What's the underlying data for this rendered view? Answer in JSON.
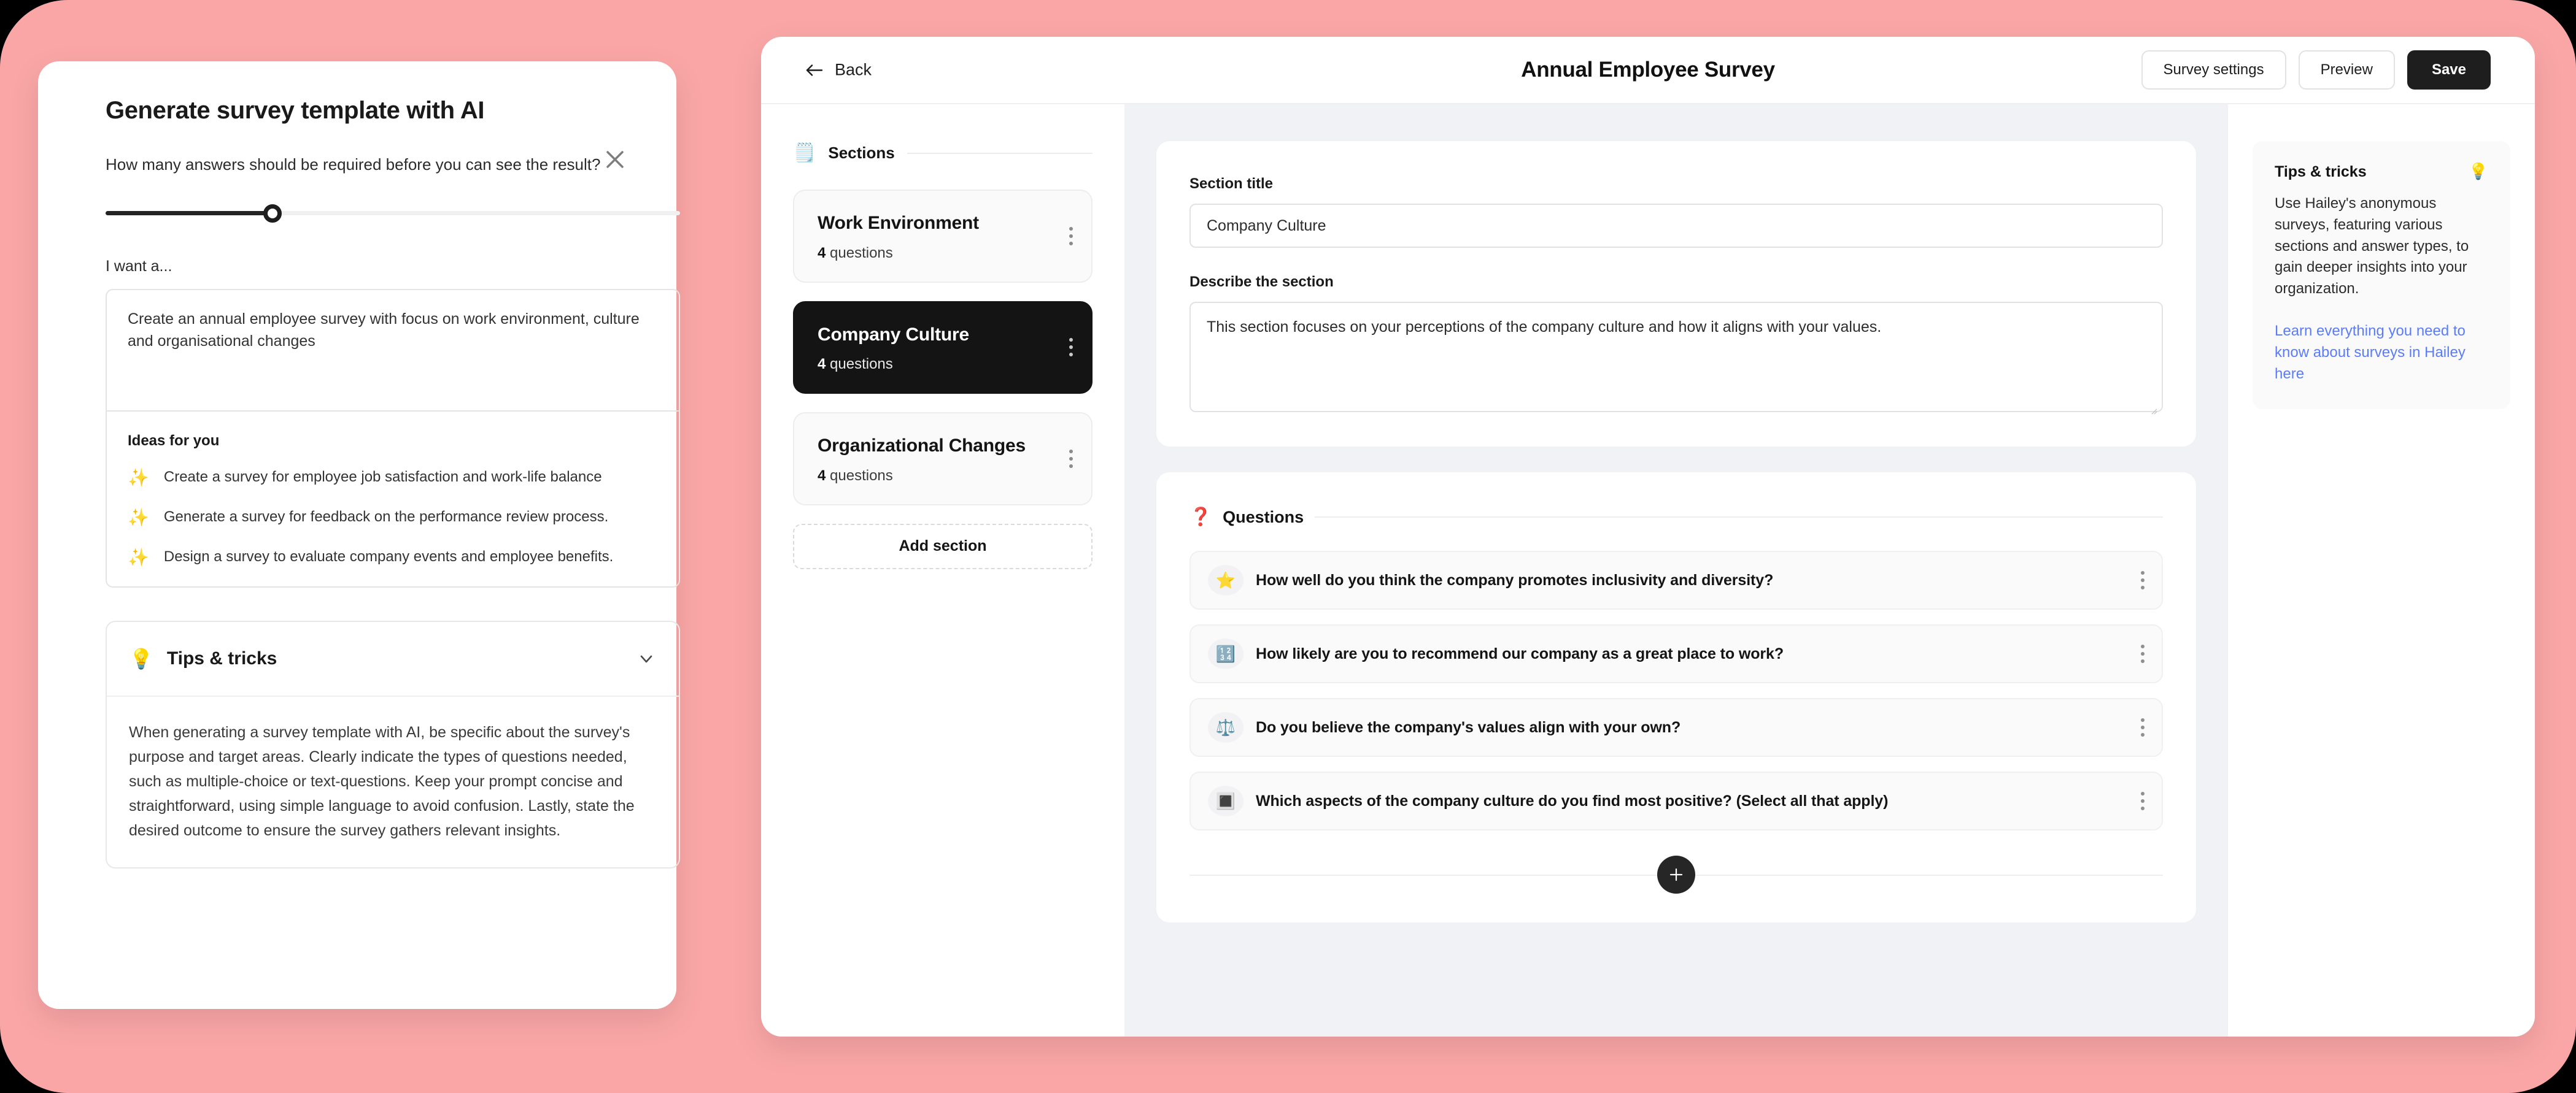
{
  "theme": {
    "page_background": "#FAA6A6",
    "accent_dark": "#1E1E1E",
    "link_blue": "#5B7CFA",
    "editor_background": "#F1F2F6"
  },
  "ai_modal": {
    "title": "Generate survey template with AI",
    "close_icon": "close-icon",
    "slider_question": "How many answers should be required before you can see the result?",
    "slider_fill_percent": 29,
    "prompt_label": "I want a...",
    "prompt_value": "Create an annual employee survey with focus on work environment, culture and organisational changes",
    "ideas_title": "Ideas for you",
    "ideas": [
      {
        "icon": "sparkles-icon",
        "glyph": "✨",
        "text": "Create a survey for employee job satisfaction and work-life balance"
      },
      {
        "icon": "sparkles-icon",
        "glyph": "✨",
        "text": "Generate a survey for feedback on the performance review process."
      },
      {
        "icon": "sparkles-icon",
        "glyph": "✨",
        "text": "Design a survey to evaluate company events and employee benefits."
      }
    ],
    "tips": {
      "icon": "lightbulb-icon",
      "glyph": "💡",
      "title": "Tips & tricks",
      "chevron_icon": "chevron-down-icon",
      "body": "When generating a survey template with AI, be specific about the survey's purpose and target areas. Clearly indicate the types of questions needed, such as multiple-choice or text-questions. Keep your prompt concise and straightforward, using simple language to avoid confusion. Lastly, state the desired outcome to ensure the survey gathers relevant insights."
    }
  },
  "app": {
    "topbar": {
      "back_label": "Back",
      "back_icon": "arrow-left-icon",
      "title": "Annual Employee Survey",
      "survey_settings_label": "Survey settings",
      "preview_label": "Preview",
      "save_label": "Save"
    },
    "sections_panel": {
      "heading": "Sections",
      "heading_icon": "notepad-icon",
      "heading_glyph": "🗒️",
      "kebab_icon": "more-vertical-icon",
      "items": [
        {
          "name": "Work Environment",
          "count": "4",
          "count_unit": "questions",
          "active": false
        },
        {
          "name": "Company Culture",
          "count": "4",
          "count_unit": "questions",
          "active": true
        },
        {
          "name": "Organizational Changes",
          "count": "4",
          "count_unit": "questions",
          "active": false
        }
      ],
      "add_section_label": "Add section"
    },
    "editor": {
      "section_title_label": "Section title",
      "section_title_value": "Company Culture",
      "describe_label": "Describe the section",
      "describe_value": "This section focuses on your perceptions of the company culture and how it aligns with your values.",
      "questions_heading": "Questions",
      "questions_heading_icon": "question-mark-icon",
      "questions_heading_glyph": "❓",
      "questions": [
        {
          "icon": "star-rating-icon",
          "glyph": "⭐",
          "text": "How well do you think the company promotes inclusivity and diversity?"
        },
        {
          "icon": "number-scale-icon",
          "glyph": "🔢",
          "text": "How likely are you to recommend our company as a great place to work?"
        },
        {
          "icon": "balance-scale-icon",
          "glyph": "⚖️",
          "text": "Do you believe the company's values align with your own?"
        },
        {
          "icon": "checkbox-icon",
          "glyph": "🔳",
          "text": "Which aspects of the company culture do you find most positive? (Select all that apply)"
        }
      ],
      "add_question_icon": "plus-icon",
      "add_question_glyph": "+"
    },
    "tips_panel": {
      "title": "Tips & tricks",
      "icon": "lightbulb-icon",
      "glyph": "💡",
      "body": "Use Hailey's anonymous surveys, featuring various sections and answer types, to gain deeper insights into your organization.",
      "link_text": "Learn everything you need to know about surveys in Hailey here"
    }
  }
}
